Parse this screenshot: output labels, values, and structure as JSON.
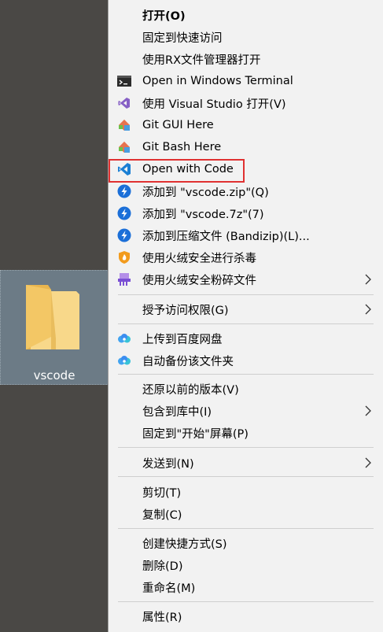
{
  "desktop": {
    "folder_name": "vscode"
  },
  "menu": {
    "items": [
      {
        "label": "打开(O)",
        "icon": ""
      },
      {
        "label": "固定到快速访问",
        "icon": ""
      },
      {
        "label": "使用RX文件管理器打开",
        "icon": ""
      },
      {
        "label": "Open in Windows Terminal",
        "icon": "terminal-icon"
      },
      {
        "label": "使用 Visual Studio 打开(V)",
        "icon": "visual-studio-icon"
      },
      {
        "label": "Git GUI Here",
        "icon": "git-gui-icon"
      },
      {
        "label": "Git Bash Here",
        "icon": "git-bash-icon"
      },
      {
        "label": "Open with Code",
        "icon": "vscode-icon"
      },
      {
        "label": "添加到 \"vscode.zip\"(Q)",
        "icon": "bandizip-icon"
      },
      {
        "label": "添加到 \"vscode.7z\"(7)",
        "icon": "bandizip-icon"
      },
      {
        "label": "添加到压缩文件 (Bandizip)(L)...",
        "icon": "bandizip-icon"
      },
      {
        "label": "使用火绒安全进行杀毒",
        "icon": "huorong-shield-icon"
      },
      {
        "label": "使用火绒安全粉碎文件",
        "icon": "shredder-icon"
      },
      {
        "label": "授予访问权限(G)",
        "icon": ""
      },
      {
        "label": "上传到百度网盘",
        "icon": "baidu-netdisk-icon"
      },
      {
        "label": "自动备份该文件夹",
        "icon": "baidu-netdisk-icon"
      },
      {
        "label": "还原以前的版本(V)",
        "icon": ""
      },
      {
        "label": "包含到库中(I)",
        "icon": ""
      },
      {
        "label": "固定到\"开始\"屏幕(P)",
        "icon": ""
      },
      {
        "label": "发送到(N)",
        "icon": ""
      },
      {
        "label": "剪切(T)",
        "icon": ""
      },
      {
        "label": "复制(C)",
        "icon": ""
      },
      {
        "label": "创建快捷方式(S)",
        "icon": ""
      },
      {
        "label": "删除(D)",
        "icon": ""
      },
      {
        "label": "重命名(M)",
        "icon": ""
      },
      {
        "label": "属性(R)",
        "icon": ""
      }
    ],
    "highlight_color": "#e03131"
  }
}
